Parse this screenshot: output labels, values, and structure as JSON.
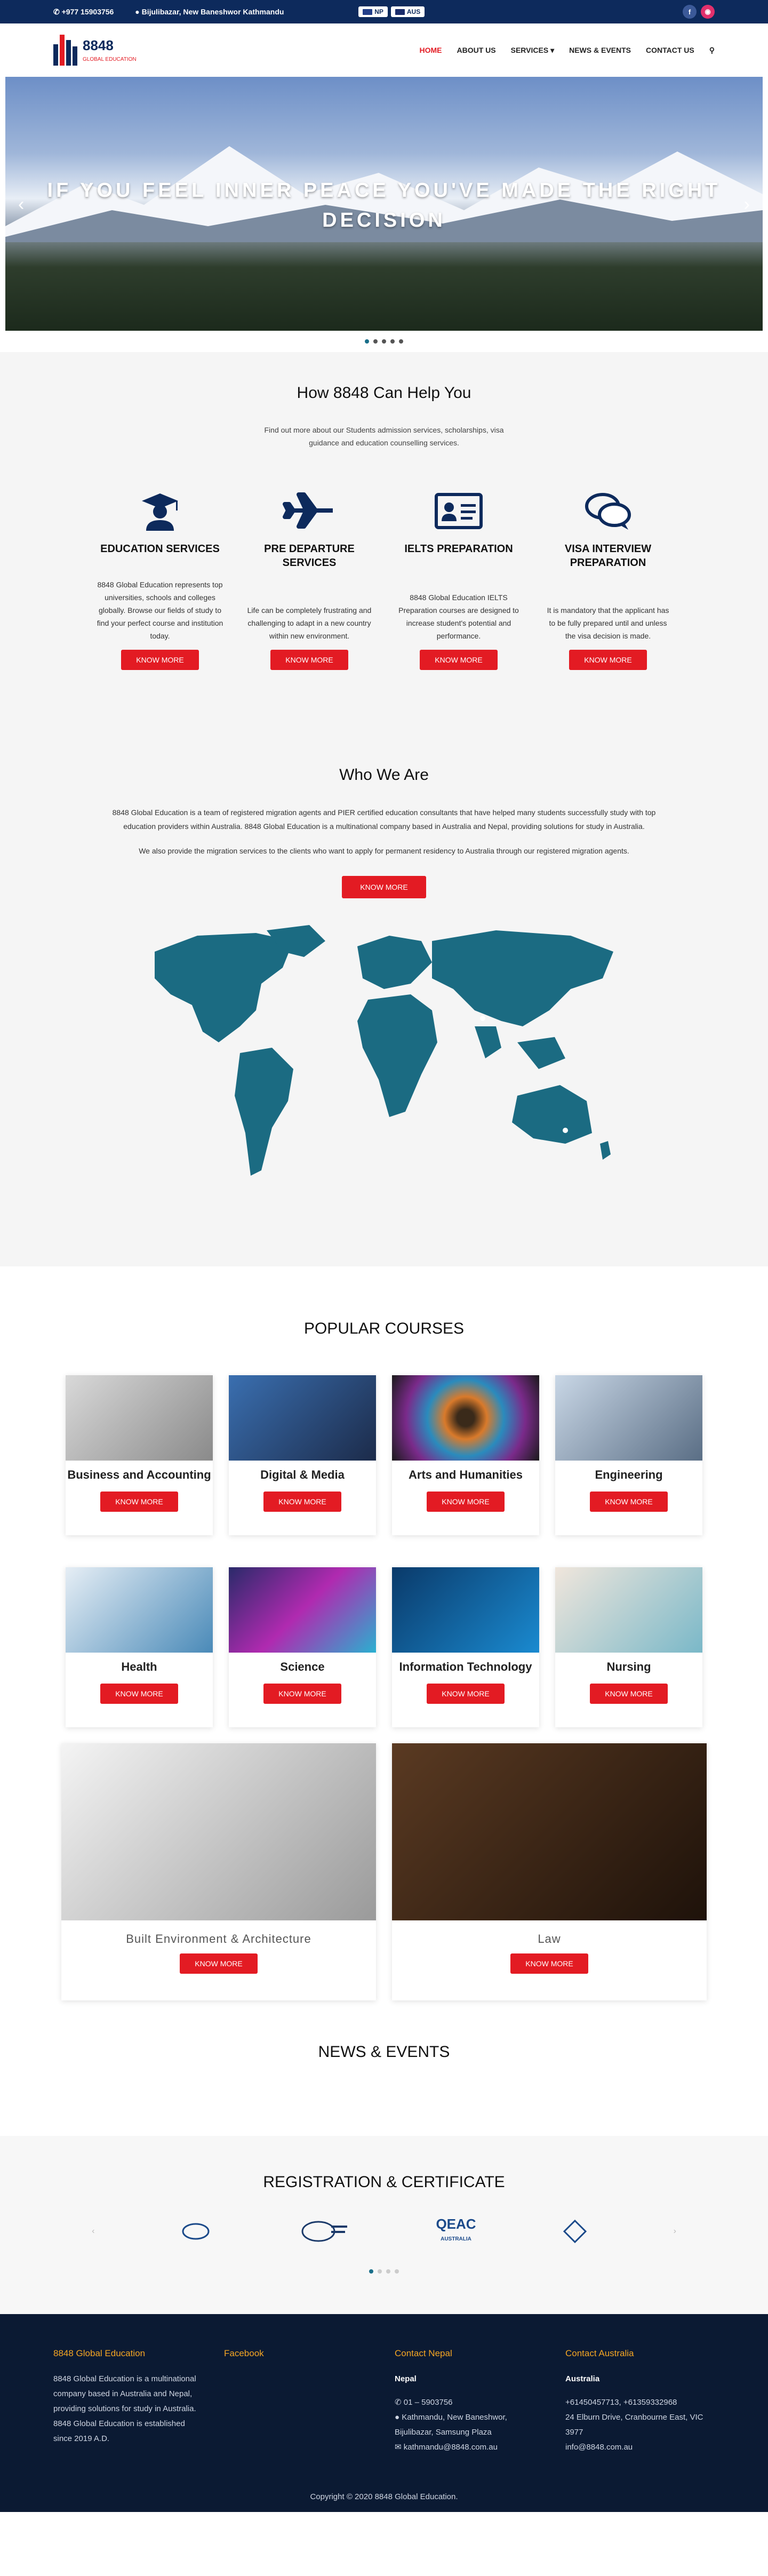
{
  "topbar": {
    "phone": "+977 15903756",
    "address": "Bijulibazar, New Baneshwor Kathmandu",
    "lang_np": "NP",
    "lang_aus": "AUS"
  },
  "header": {
    "logo": "8848",
    "logo_sub": "GLOBAL EDUCATION"
  },
  "nav": {
    "home": "HOME",
    "about": "ABOUT US",
    "services": "SERVICES",
    "news": "NEWS & EVENTS",
    "contact": "CONTACT US"
  },
  "hero": {
    "title": "IF YOU FEEL INNER PEACE YOU'VE MADE THE RIGHT DECISION"
  },
  "help": {
    "title": "How 8848 Can Help You",
    "lead": "Find out more about our Students admission services, scholarships, visa guidance and education counselling services.",
    "services": [
      {
        "title": "EDUCATION SERVICES",
        "text": "8848 Global Education represents top universities, schools and colleges globally. Browse our fields of study to find your perfect course and institution today.",
        "btn": "KNOW MORE"
      },
      {
        "title": "PRE DEPARTURE SERVICES",
        "text": "Life can be completely frustrating and challenging to adapt in a new country within new environment.",
        "btn": "KNOW MORE"
      },
      {
        "title": "IELTS PREPARATION",
        "text": "8848 Global Education IELTS Preparation courses are designed to increase student's potential and performance.",
        "btn": "KNOW MORE"
      },
      {
        "title": "VISA INTERVIEW PREPARATION",
        "text": "It is mandatory that the applicant has to be fully prepared until and unless the visa decision is made.",
        "btn": "KNOW MORE"
      }
    ]
  },
  "who": {
    "title": "Who We Are",
    "p1": "8848 Global Education is a team of registered migration agents and PIER certified education consultants that have helped many students successfully study with top education providers within Australia. 8848 Global Education is a multinational company based in Australia and Nepal, providing solutions for study in Australia.",
    "p2": "We also provide the migration services to the clients who want to apply for permanent residency to Australia through our registered migration agents.",
    "btn": "KNOW MORE"
  },
  "popular": {
    "title": "POPULAR COURSES",
    "courses": [
      {
        "name": "Business and Accounting",
        "btn": "KNOW MORE"
      },
      {
        "name": "Digital & Media",
        "btn": "KNOW MORE"
      },
      {
        "name": "Arts and Humanities",
        "btn": "KNOW MORE"
      },
      {
        "name": "Engineering",
        "btn": "KNOW MORE"
      },
      {
        "name": "Health",
        "btn": "KNOW MORE"
      },
      {
        "name": "Science",
        "btn": "KNOW MORE"
      },
      {
        "name": "Information Technology",
        "btn": "KNOW MORE"
      },
      {
        "name": "Nursing",
        "btn": "KNOW MORE"
      }
    ],
    "wide": [
      {
        "name": "Built Environment & Architecture",
        "btn": "KNOW MORE"
      },
      {
        "name": "Law",
        "btn": "KNOW MORE"
      }
    ]
  },
  "news": {
    "title": "NEWS & EVENTS"
  },
  "reg": {
    "title": "REGISTRATION & CERTIFICATE",
    "qeac": "QEAC",
    "qeac_sub": "AUSTRALIA"
  },
  "footer": {
    "c1_title": "8848 Global Education",
    "c1_text": "8848 Global Education is a multinational company based in Australia and Nepal, providing solutions for study in Australia. 8848 Global Education is established since 2019 A.D.",
    "c2_title": "Facebook",
    "c3_title": "Contact Nepal",
    "c3_sub": "Nepal",
    "c3_phone": "01 – 5903756",
    "c3_addr": "Kathmandu, New Baneshwor, Bijulibazar, Samsung Plaza",
    "c3_email": "kathmandu@8848.com.au",
    "c4_title": "Contact Australia",
    "c4_sub": "Australia",
    "c4_phone": "+61450457713, +61359332968",
    "c4_addr": "24 Elburn Drive, Cranbourne East, VIC 3977",
    "c4_email": "info@8848.com.au",
    "copyright": "Copyright © 2020 8848 Global Education."
  },
  "colors": {
    "navy": "#0d2a5c",
    "red": "#e31b23",
    "map": "#1b6b82",
    "footer": "#0b1a33"
  }
}
